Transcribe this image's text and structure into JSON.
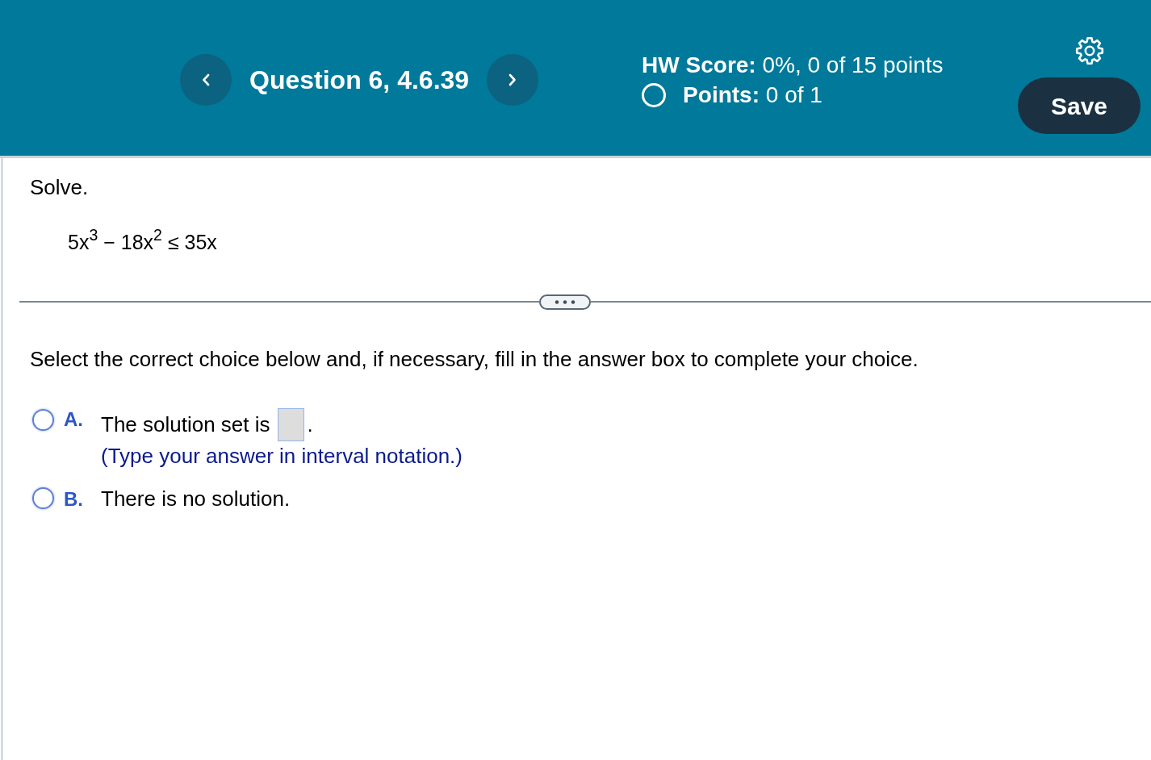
{
  "header": {
    "question_title": "Question 6, 4.6.39",
    "hw_score": "**HW Score:** 0%, 0 of 15 points",
    "points": "**Points:** 0 of 1",
    "save_label": "Save"
  },
  "question": {
    "instruction": "Solve.",
    "equation": "5x$^{3}$ − 18x$^{2}$ ≤ 35x"
  },
  "prompt": "Select the correct choice below and, if necessary, fill in the answer box to complete your choice.",
  "choices": [
    {
      "letter": "A.",
      "kind": "answer_box",
      "text": "The solution set is",
      "after": ".",
      "hint": "(Type your answer in interval notation.)",
      "selected": false
    },
    {
      "letter": "B.",
      "kind": "plain",
      "text": "There is no solution.",
      "selected": false
    }
  ]
}
